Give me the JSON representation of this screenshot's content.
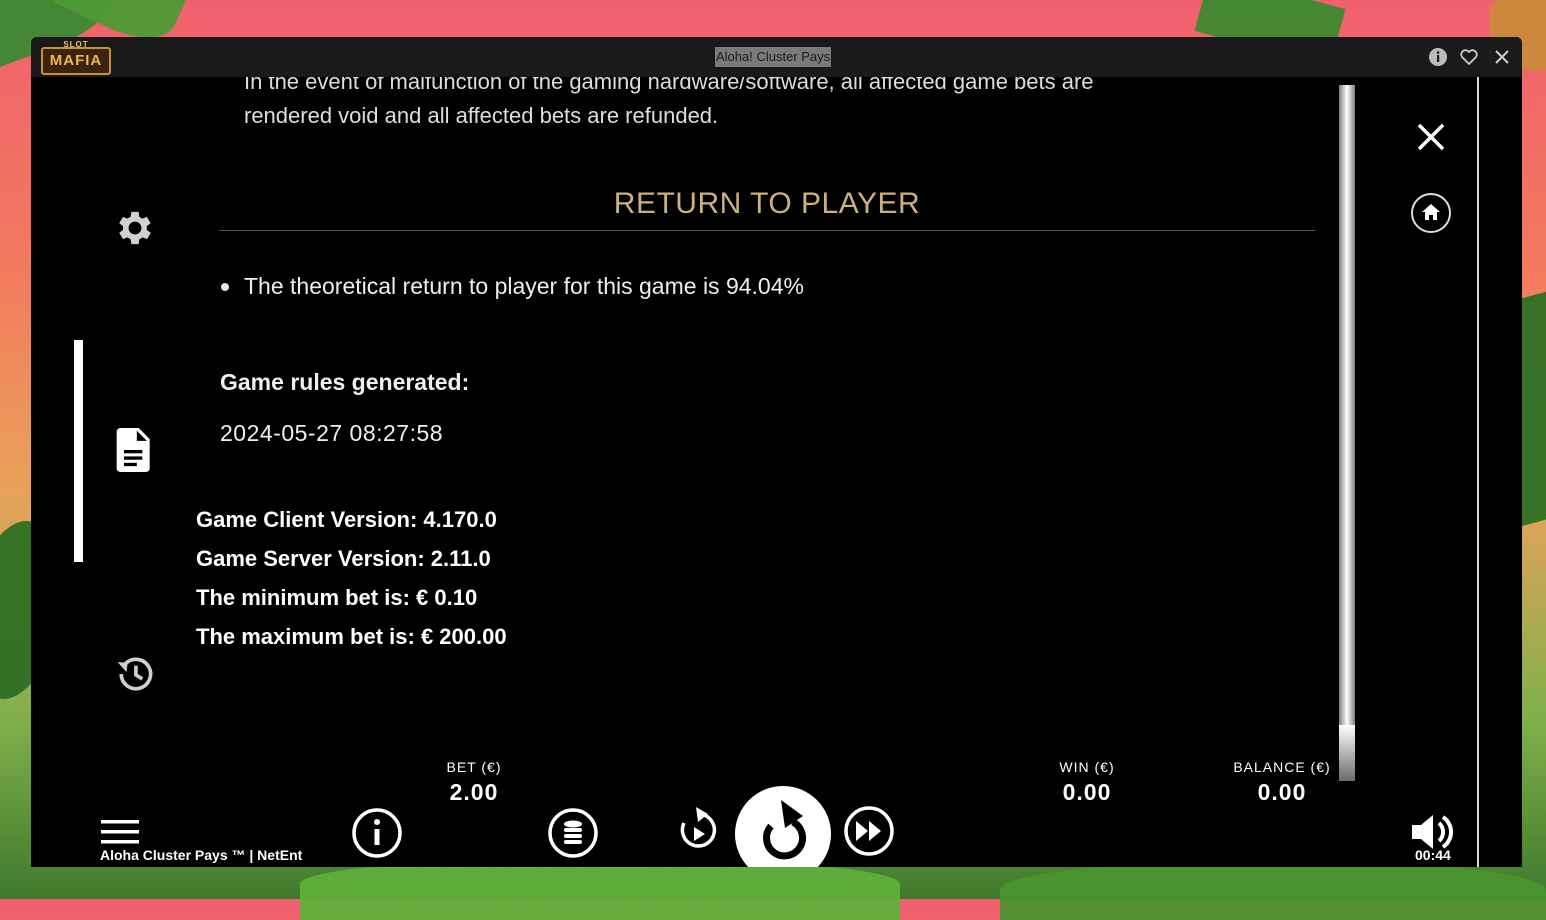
{
  "window": {
    "title": "Aloha! Cluster Pays",
    "logo_top": "SLOT",
    "logo_main": "MAFIA"
  },
  "rules": {
    "cut_line": "In the event of malfunction of the gaming hardware/software, all affected game bets are",
    "void_line": "rendered void and all affected bets are refunded.",
    "section_title": "RETURN TO PLAYER",
    "rtp_text": "The theoretical return to player for this game is 94.04%",
    "generated_label": "Game rules generated:",
    "generated_date": "2024-05-27 08:27:58",
    "client_version": "Game Client Version: 4.170.0",
    "server_version": "Game Server Version: 2.11.0",
    "min_bet": "The minimum bet is: € 0.10",
    "max_bet": "The maximum bet is: € 200.00"
  },
  "sidebar": {
    "items": [
      {
        "icon": "gear-icon",
        "active": false
      },
      {
        "icon": "document-icon",
        "active": true
      },
      {
        "icon": "history-icon",
        "active": false
      }
    ]
  },
  "controls": {
    "bet_label": "BET (€)",
    "bet_value": "2.00",
    "win_label": "WIN (€)",
    "win_value": "0.00",
    "balance_label": "BALANCE (€)",
    "balance_value": "0.00"
  },
  "footer": {
    "game_info": "Aloha Cluster Pays ™  |  NetEnt",
    "clock": "00:44"
  },
  "colors": {
    "accent_gold": "#cdb07a",
    "background": "#000000",
    "text": "#ffffff"
  }
}
